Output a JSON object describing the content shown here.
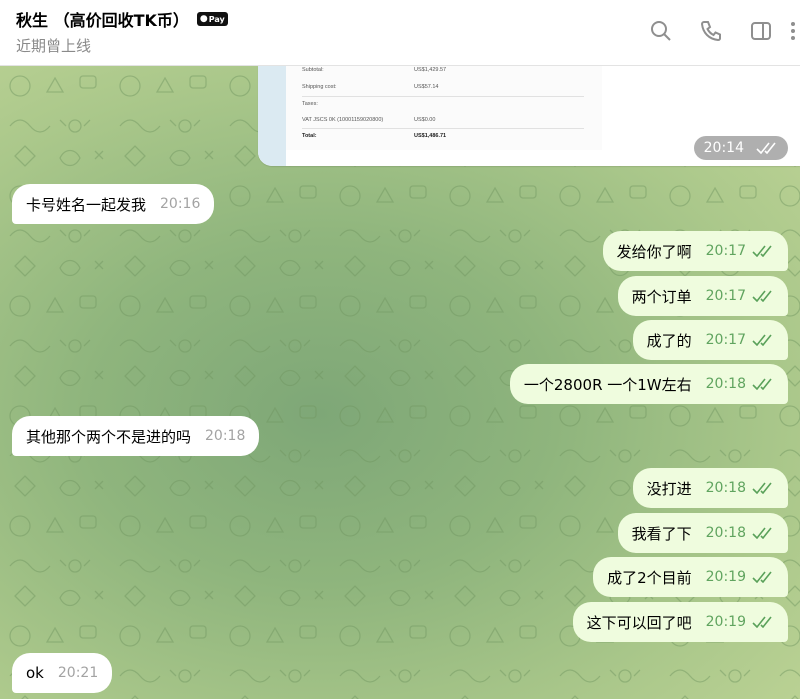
{
  "header": {
    "title": "秋生 （高价回收TK币）",
    "badge": "Pay",
    "status": "近期曾上线"
  },
  "icons": {
    "search": "search-icon",
    "call": "phone-icon",
    "panel": "sidebar-toggle-icon",
    "more": "more-vertical-icon"
  },
  "colors": {
    "incoming_bubble": "#ffffff",
    "outgoing_bubble": "#effcde",
    "time_outgoing": "#60a45f",
    "ticks": "#5aa15a"
  },
  "image_message": {
    "receipt": {
      "subtotal_label": "Subtotal:",
      "subtotal_value": "US$1,429.57",
      "shipping_label": "Shipping cost:",
      "shipping_value": "US$57.14",
      "taxes_label": "Taxes:",
      "vat_label": "VAT JSCS 0K (10001159020800)",
      "vat_value": "US$0.00",
      "total_label": "Total:",
      "total_value": "US$1,486.71"
    },
    "time": "20:14"
  },
  "messages": [
    {
      "dir": "in",
      "text": "卡号姓名一起发我",
      "time": "20:16"
    },
    {
      "dir": "out",
      "text": "发给你了啊",
      "time": "20:17"
    },
    {
      "dir": "out",
      "text": "两个订单",
      "time": "20:17"
    },
    {
      "dir": "out",
      "text": "成了的",
      "time": "20:17"
    },
    {
      "dir": "out",
      "text": "一个2800R  一个1W左右",
      "time": "20:18"
    },
    {
      "dir": "in",
      "text": "其他那个两个不是进的吗",
      "time": "20:18"
    },
    {
      "dir": "out",
      "text": "没打进",
      "time": "20:18"
    },
    {
      "dir": "out",
      "text": "我看了下",
      "time": "20:18"
    },
    {
      "dir": "out",
      "text": "成了2个目前",
      "time": "20:19"
    },
    {
      "dir": "out",
      "text": "这下可以回了吧",
      "time": "20:19"
    },
    {
      "dir": "in",
      "text": "ok",
      "time": "20:21"
    }
  ]
}
